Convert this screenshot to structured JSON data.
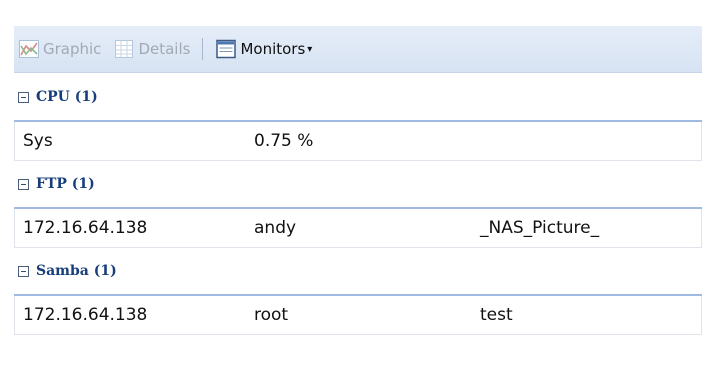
{
  "toolbar": {
    "graphic_label": "Graphic",
    "details_label": "Details",
    "monitors_label": "Monitors",
    "caret": "▾"
  },
  "groups": [
    {
      "title": "CPU (1)",
      "toggle": "⊟",
      "rows": [
        [
          "Sys",
          "0.75 %",
          ""
        ]
      ]
    },
    {
      "title": "FTP (1)",
      "toggle": "⊟",
      "rows": [
        [
          "172.16.64.138",
          "andy",
          "_NAS_Picture_"
        ]
      ]
    },
    {
      "title": "Samba (1)",
      "toggle": "⊟",
      "rows": [
        [
          "172.16.64.138",
          "root",
          "test"
        ]
      ]
    }
  ],
  "colors": {
    "toolbar_bg": "#dde7f5",
    "group_title": "#173d7a",
    "group_rule": "#a0badf",
    "disabled_text": "#a2a9b3"
  },
  "icons": {
    "graphic": "chart-icon",
    "details": "table-icon",
    "monitors": "monitor-icon"
  }
}
